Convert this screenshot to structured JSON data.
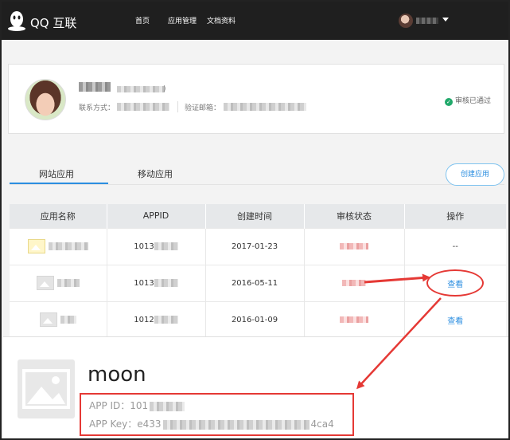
{
  "topnav": {
    "brand": "QQ 互联",
    "links": [
      "首页",
      "应用管理",
      "文档资料"
    ]
  },
  "profile": {
    "name_suffix": ")",
    "contact_label": "联系方式：",
    "email_label": "验证邮箱：",
    "status": "审核已通过"
  },
  "tabs": {
    "web": "网站应用",
    "mobile": "移动应用",
    "create_button": "创建应用"
  },
  "table": {
    "headers": [
      "应用名称",
      "APPID",
      "创建时间",
      "审核状态",
      "操作"
    ],
    "rows": [
      {
        "appid": "1013",
        "created": "2017-01-23",
        "action": "--"
      },
      {
        "appid": "1013",
        "created": "2016-05-11",
        "action": "查看"
      },
      {
        "appid": "1012",
        "created": "2016-01-09",
        "action": "查看"
      }
    ]
  },
  "zoom": {
    "app_name": "moon",
    "app_id_line": "APP ID：101",
    "app_key_prefix": "APP Key：e433",
    "app_key_suffix": "4ca4"
  },
  "colors": {
    "nav_bg": "#1f1f1f",
    "accent_blue": "#2b8ee0",
    "success_green": "#21a96b",
    "annotation_red": "#e53935"
  }
}
